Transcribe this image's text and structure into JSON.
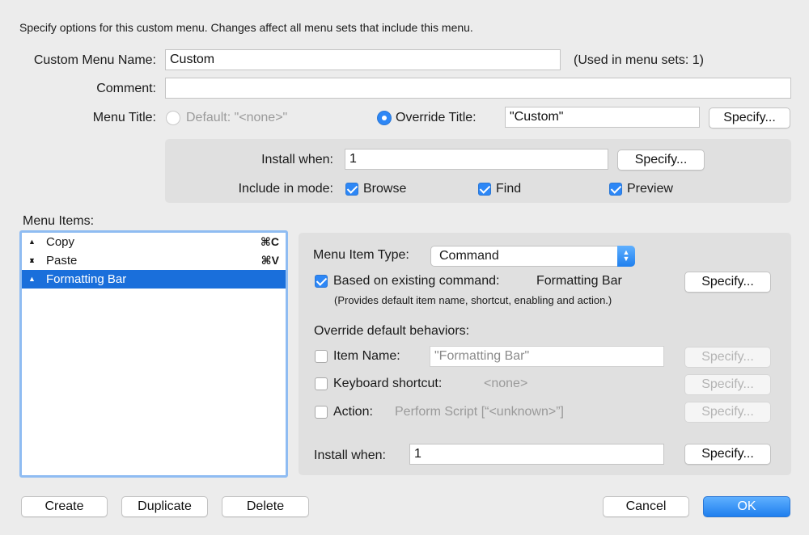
{
  "header": {
    "instructions": "Specify options for this custom menu.  Changes affect all menu sets that include this menu."
  },
  "menu": {
    "name_label": "Custom Menu Name:",
    "name_value": "Custom",
    "used_in": "(Used in menu sets: 1)",
    "comment_label": "Comment:",
    "comment_value": "",
    "title_label": "Menu Title:",
    "default_label": "Default: \"<none>\"",
    "override_label": "Override Title:",
    "override_value": "\"Custom\"",
    "specify_label": "Specify...",
    "selected_title_option": "override"
  },
  "install": {
    "label": "Install when:",
    "value": "1",
    "specify_label": "Specify...",
    "include_label": "Include in mode:",
    "modes": [
      {
        "label": "Browse",
        "checked": true
      },
      {
        "label": "Find",
        "checked": true
      },
      {
        "label": "Preview",
        "checked": true
      }
    ]
  },
  "items": {
    "label": "Menu Items:",
    "list": [
      {
        "name": "Copy",
        "shortcut": "⌘C",
        "selected": false
      },
      {
        "name": "Paste",
        "shortcut": "⌘V",
        "selected": false
      },
      {
        "name": "Formatting Bar",
        "shortcut": "",
        "selected": true
      }
    ]
  },
  "detail": {
    "type_label": "Menu Item Type:",
    "type_value": "Command",
    "based_label": "Based on existing command:",
    "based_checked": true,
    "based_value": "Formatting Bar",
    "specify_label": "Specify...",
    "note": "(Provides default item name, shortcut, enabling and action.)",
    "override_heading": "Override default behaviors:",
    "item_name_label": "Item Name:",
    "item_name_value": "\"Formatting Bar\"",
    "shortcut_label": "Keyboard shortcut:",
    "shortcut_value": "<none>",
    "action_label": "Action:",
    "action_value": "Perform Script [“<unknown>”]",
    "install_label": "Install when:",
    "install_value": "1"
  },
  "footer": {
    "create": "Create",
    "duplicate": "Duplicate",
    "delete": "Delete",
    "cancel": "Cancel",
    "ok": "OK"
  },
  "colors": {
    "accent": "#2d87f6",
    "selection": "#1a6fdb",
    "panel": "#e0e0e0",
    "background": "#ececec"
  }
}
